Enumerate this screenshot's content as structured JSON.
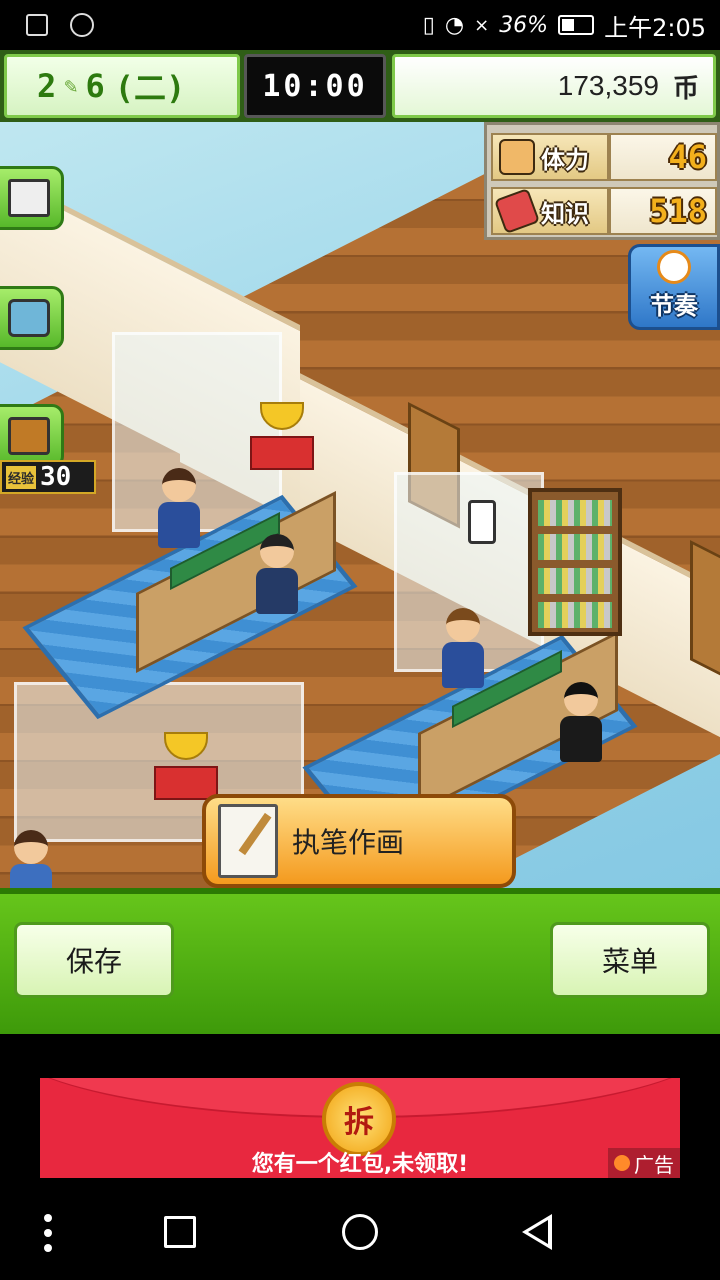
{
  "status_bar": {
    "battery_percent": "36%",
    "time": "上午2:05",
    "signal_mark": "×",
    "icons": [
      "image-icon",
      "timer-icon",
      "vibrate-icon",
      "wifi-icon",
      "battery-icon"
    ],
    "battery_level": 0.36
  },
  "top_bar": {
    "month": "2",
    "week": "6",
    "weekday": "(二)",
    "game_time": "10:00",
    "money": "173,359",
    "money_unit": "币"
  },
  "stats": {
    "stamina_label": "体力",
    "stamina_value": "46",
    "knowledge_label": "知识",
    "knowledge_value": "518"
  },
  "rhythm_label": "节奏",
  "exp_badge": {
    "label": "经验",
    "value": "30"
  },
  "left_tools": [
    "notebook-pencil-icon",
    "camera-icon",
    "briefcase-icon"
  ],
  "action_button": {
    "label": "执笔作画",
    "icon": "manuscript-pen-icon"
  },
  "bottom_buttons": {
    "save": "保存",
    "menu": "菜单"
  },
  "ad": {
    "coin_text": "拆",
    "message": "您有一个红包,未领取!",
    "tag": "广告"
  },
  "colors": {
    "green_bar": "#4fae12",
    "ad_red": "#e8283f",
    "scene_sky": "#9ad5ea"
  }
}
